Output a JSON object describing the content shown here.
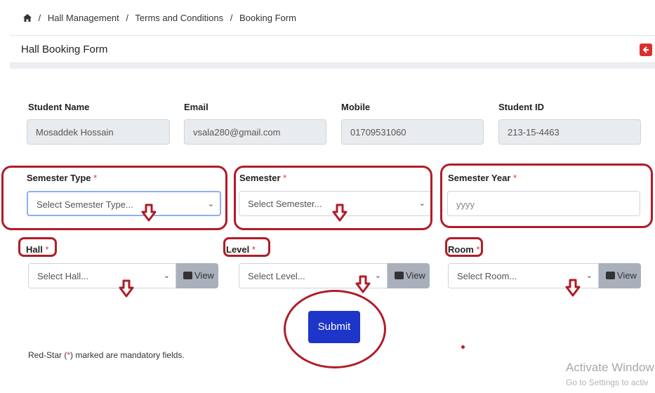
{
  "breadcrumb": {
    "items": [
      "Hall Management",
      "Terms and Conditions",
      "Booking Form"
    ],
    "separator": "/"
  },
  "header": {
    "title": "Hall Booking Form"
  },
  "student_info": {
    "name_label": "Student Name",
    "name_value": "Mosaddek Hossain",
    "email_label": "Email",
    "email_value": "vsala280@gmail.com",
    "mobile_label": "Mobile",
    "mobile_value": "01709531060",
    "id_label": "Student ID",
    "id_value": "213-15-4463"
  },
  "form": {
    "required_marker": "*",
    "semester_type_label": "Semester Type",
    "semester_type_placeholder": "Select Semester Type...",
    "semester_label": "Semester",
    "semester_placeholder": "Select Semester...",
    "semester_year_label": "Semester Year",
    "semester_year_placeholder": "yyyy",
    "hall_label": "Hall",
    "hall_placeholder": "Select Hall...",
    "level_label": "Level",
    "level_placeholder": "Select Level...",
    "room_label": "Room",
    "room_placeholder": "Select Room...",
    "view_label": "View",
    "submit_label": "Submit"
  },
  "note": {
    "prefix": "Red-Star (",
    "star": "*",
    "suffix": ") marked are mandatory fields."
  },
  "watermark": {
    "line1": "Activate Window",
    "line2": "Go to Settings to activ"
  },
  "colors": {
    "annotation_red": "#b01c28",
    "submit_blue": "#1d35c8",
    "required_red": "#e0303a",
    "view_gray": "#a9b0bb"
  },
  "icons": {
    "home": "home-icon",
    "back": "back-arrow-icon",
    "image": "image-icon",
    "chevron": "chevron-down-icon",
    "annotation": "down-arrow-icon"
  }
}
